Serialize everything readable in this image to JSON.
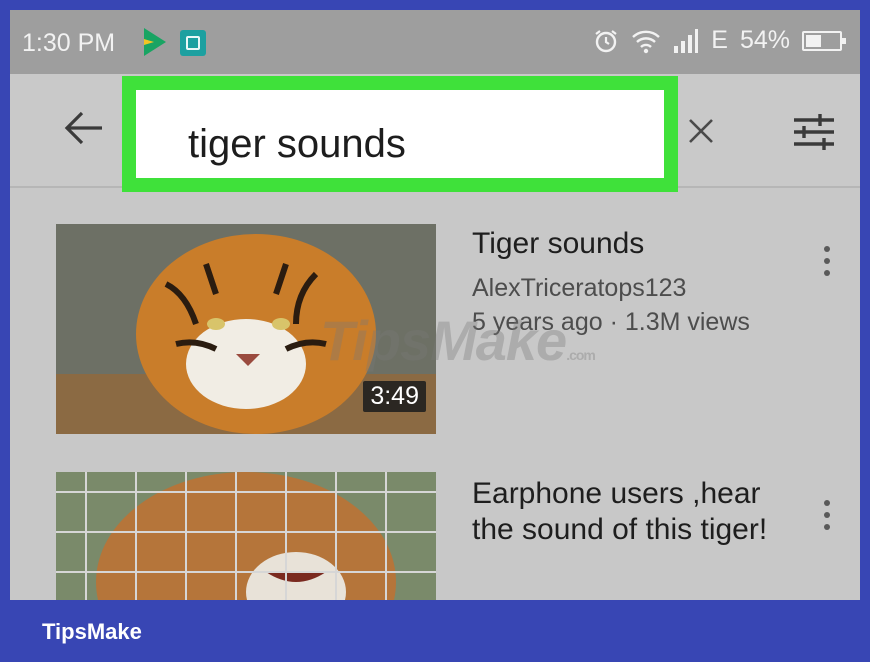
{
  "status_bar": {
    "time": "1:30 PM",
    "network": "E",
    "battery_percent": "54%",
    "battery_level": 0.54
  },
  "search": {
    "query": "tiger sounds"
  },
  "results": [
    {
      "title": "Tiger sounds",
      "channel": "AlexTriceratops123",
      "meta": "5 years ago · 1.3M views",
      "duration": "3:49"
    },
    {
      "title": "Earphone users ,hear the sound of this tiger!"
    }
  ],
  "watermark": {
    "text": "TipsMake",
    "suffix": ".com"
  },
  "footer": {
    "brand": "TipsMake"
  },
  "colors": {
    "highlight": "#3fe13a",
    "brand_bar": "#3846b4",
    "status_bar": "#9e9e9e"
  },
  "icons": [
    "play-store-icon",
    "screenshot-icon",
    "alarm-icon",
    "wifi-icon",
    "signal-icon",
    "battery-icon",
    "back-arrow-icon",
    "clear-icon",
    "filter-icon",
    "more-vert-icon"
  ]
}
